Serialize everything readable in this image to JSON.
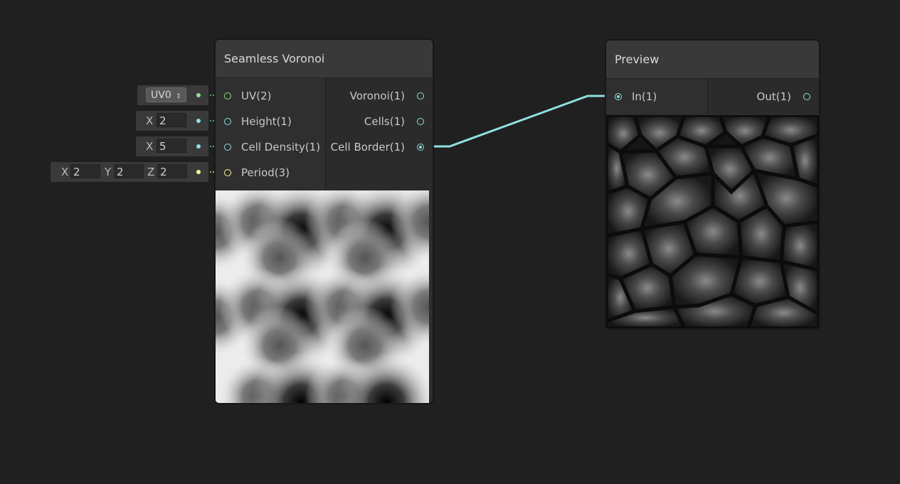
{
  "nodes": {
    "voronoi": {
      "title": "Seamless Voronoi",
      "inputs": [
        "UV(2)",
        "Height(1)",
        "Cell Density(1)",
        "Period(3)"
      ],
      "outputs": [
        "Voronoi(1)",
        "Cells(1)",
        "Cell Border(1)"
      ]
    },
    "preview": {
      "title": "Preview",
      "inputs": [
        "In(1)"
      ],
      "outputs": [
        "Out(1)"
      ]
    }
  },
  "inline_inputs": {
    "uv": {
      "value": "UV0",
      "icon": "up-down-arrows-icon"
    },
    "height": {
      "axis": "X",
      "value": "2"
    },
    "cell_density": {
      "axis": "X",
      "value": "5"
    },
    "period": {
      "x_label": "X",
      "x": "2",
      "y_label": "Y",
      "y": "2",
      "z_label": "Z",
      "z": "2"
    }
  },
  "colors": {
    "background": "#202020",
    "port_float": "#8fe0e0",
    "port_vector2": "#8fe08f",
    "port_vector3": "#ffff99",
    "connection": "#8fe0e0"
  }
}
